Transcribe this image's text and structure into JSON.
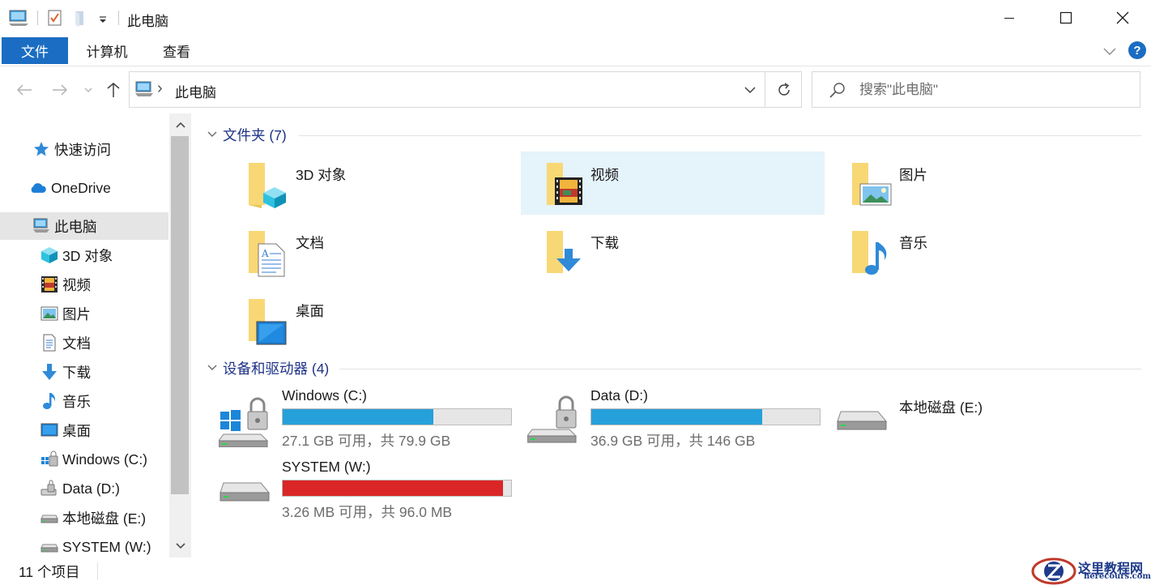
{
  "window": {
    "title": "此电脑",
    "controls": {
      "minimize": "minimize-icon",
      "maximize": "maximize-icon",
      "close": "close-icon"
    }
  },
  "ribbon": {
    "tabs": [
      {
        "label": "文件"
      },
      {
        "label": "计算机"
      },
      {
        "label": "查看"
      }
    ],
    "help_label": "?"
  },
  "address": {
    "path": "此电脑",
    "separator": "›"
  },
  "search": {
    "placeholder": "搜索\"此电脑\""
  },
  "sidebar": {
    "items": [
      {
        "label": "快速访问",
        "icon": "star-icon"
      },
      {
        "label": "OneDrive",
        "icon": "cloud-icon"
      },
      {
        "label": "此电脑",
        "icon": "computer-icon",
        "selected": true
      },
      {
        "label": "3D 对象",
        "icon": "cube-icon"
      },
      {
        "label": "视频",
        "icon": "film-icon"
      },
      {
        "label": "图片",
        "icon": "picture-icon"
      },
      {
        "label": "文档",
        "icon": "document-icon"
      },
      {
        "label": "下载",
        "icon": "download-icon"
      },
      {
        "label": "音乐",
        "icon": "music-icon"
      },
      {
        "label": "桌面",
        "icon": "desktop-icon"
      },
      {
        "label": "Windows (C:)",
        "icon": "windows-drive-icon"
      },
      {
        "label": "Data (D:)",
        "icon": "locked-drive-icon"
      },
      {
        "label": "本地磁盘 (E:)",
        "icon": "drive-icon"
      },
      {
        "label": "SYSTEM (W:)",
        "icon": "drive-icon"
      }
    ]
  },
  "folders": {
    "header": "文件夹 (7)",
    "items": [
      {
        "label": "3D 对象",
        "icon": "cube-folder-icon"
      },
      {
        "label": "视频",
        "icon": "video-folder-icon",
        "highlighted": true
      },
      {
        "label": "图片",
        "icon": "picture-folder-icon"
      },
      {
        "label": "文档",
        "icon": "document-folder-icon"
      },
      {
        "label": "下载",
        "icon": "download-folder-icon"
      },
      {
        "label": "音乐",
        "icon": "music-folder-icon"
      },
      {
        "label": "桌面",
        "icon": "desktop-folder-icon"
      }
    ]
  },
  "drives": {
    "header": "设备和驱动器 (4)",
    "items": [
      {
        "label": "Windows (C:)",
        "free": "27.1 GB 可用，共 79.9 GB",
        "used_fraction": 0.661,
        "bar_color": "#26a0da",
        "icon": "windows-drive-icon"
      },
      {
        "label": "Data (D:)",
        "free": "36.9 GB 可用，共 146 GB",
        "used_fraction": 0.747,
        "bar_color": "#26a0da",
        "icon": "locked-drive-icon"
      },
      {
        "label": "本地磁盘 (E:)",
        "icon": "drive-icon"
      },
      {
        "label": "SYSTEM (W:)",
        "free": "3.26 MB 可用，共 96.0 MB",
        "used_fraction": 0.966,
        "bar_color": "#da2626",
        "icon": "drive-icon"
      }
    ]
  },
  "status": {
    "items_count": "11 个项目"
  },
  "watermark": {
    "text": "这里教程网",
    "sub": "herecours.com"
  },
  "colors": {
    "accent": "#1a6dc2",
    "selection": "#e5f3fb",
    "header_text": "#1e3287",
    "bar_blue": "#26a0da",
    "bar_red": "#da2626"
  }
}
